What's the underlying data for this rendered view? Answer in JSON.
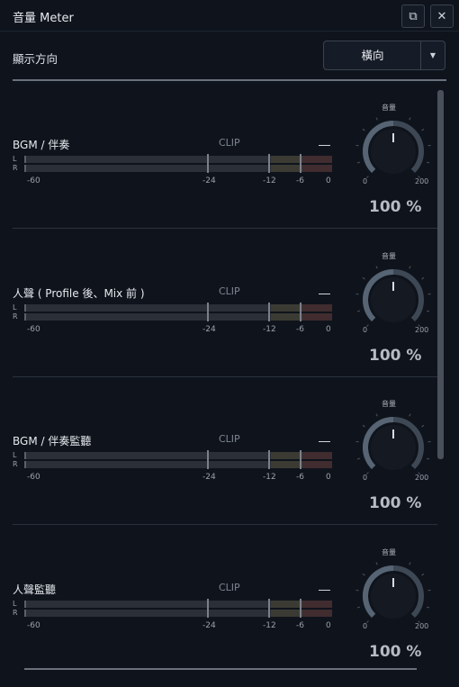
{
  "window": {
    "title": "音量 Meter",
    "popout_icon": "popout-icon",
    "close_icon": "close-icon",
    "popout_glyph": "⧉",
    "close_glyph": "✕"
  },
  "direction": {
    "label": "顯示方向",
    "value": "橫向",
    "arrow": "▼"
  },
  "meter": {
    "l_label": "L",
    "r_label": "R",
    "clip_label": "CLIP",
    "scale": [
      "-60",
      "-24",
      "-12",
      "-6",
      "0"
    ],
    "knob_label": "音量",
    "knob_min": "0",
    "knob_max": "200"
  },
  "channels": [
    {
      "name": "BGM / 伴奏",
      "volume": "100 %",
      "knob_value": 100
    },
    {
      "name": "人聲 ( Profile 後、Mix 前 )",
      "volume": "100 %",
      "knob_value": 100
    },
    {
      "name": "BGM / 伴奏監聽",
      "volume": "100 %",
      "knob_value": 100
    },
    {
      "name": "人聲監聽",
      "volume": "100 %",
      "knob_value": 100
    }
  ]
}
